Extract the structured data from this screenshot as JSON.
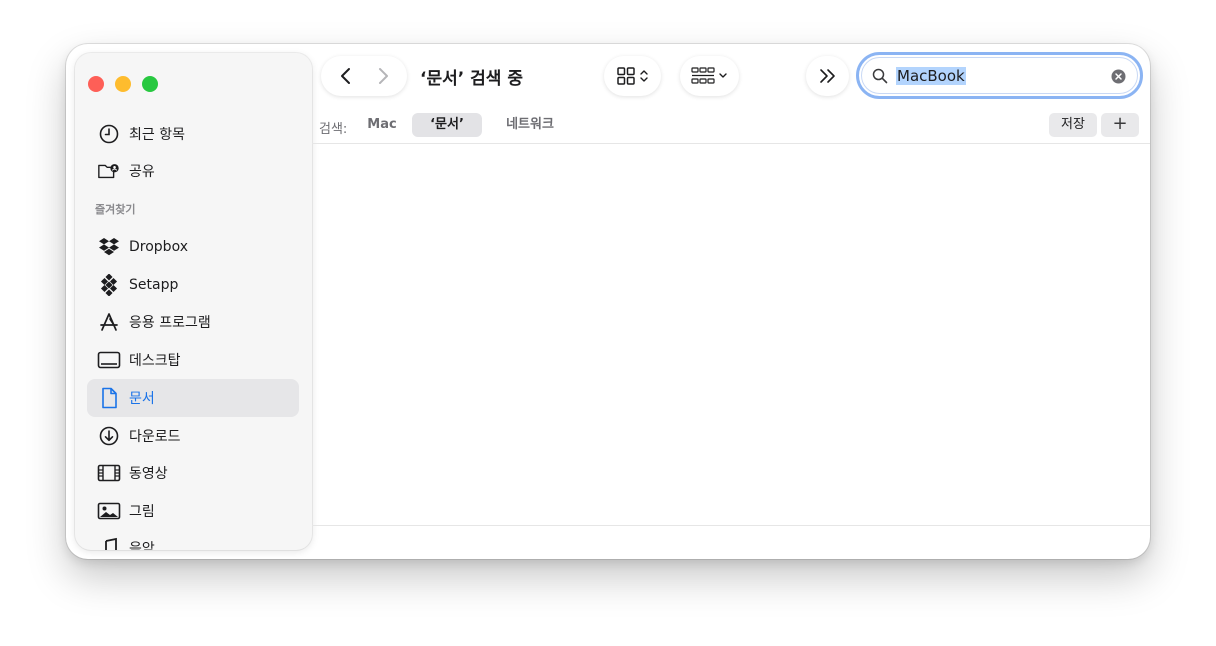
{
  "window": {
    "title": "‘문서’ 검색 중"
  },
  "sidebar": {
    "items_top": [
      {
        "label": "최근 항목",
        "icon": "clock-icon"
      },
      {
        "label": "공유",
        "icon": "shared-folder-icon"
      }
    ],
    "favorites_header": "즐겨찾기",
    "favorites": [
      {
        "label": "Dropbox",
        "icon": "dropbox-icon"
      },
      {
        "label": "Setapp",
        "icon": "setapp-icon"
      },
      {
        "label": "응용 프로그램",
        "icon": "applications-icon"
      },
      {
        "label": "데스크탑",
        "icon": "desktop-icon"
      },
      {
        "label": "문서",
        "icon": "document-icon",
        "selected": true
      },
      {
        "label": "다운로드",
        "icon": "download-icon"
      },
      {
        "label": "동영상",
        "icon": "film-icon"
      },
      {
        "label": "그림",
        "icon": "photo-icon"
      },
      {
        "label": "음악",
        "icon": "music-note-icon"
      }
    ]
  },
  "search": {
    "value": "MacBook"
  },
  "scope": {
    "label": "검색:",
    "options": [
      "Mac",
      "‘문서’",
      "네트워크"
    ],
    "active": "‘문서’",
    "save_label": "저장",
    "add_label": "+"
  },
  "colors": {
    "accent": "#1a73e8",
    "search_ring": "#8bb4f3",
    "selection": "#b3d4fd"
  }
}
